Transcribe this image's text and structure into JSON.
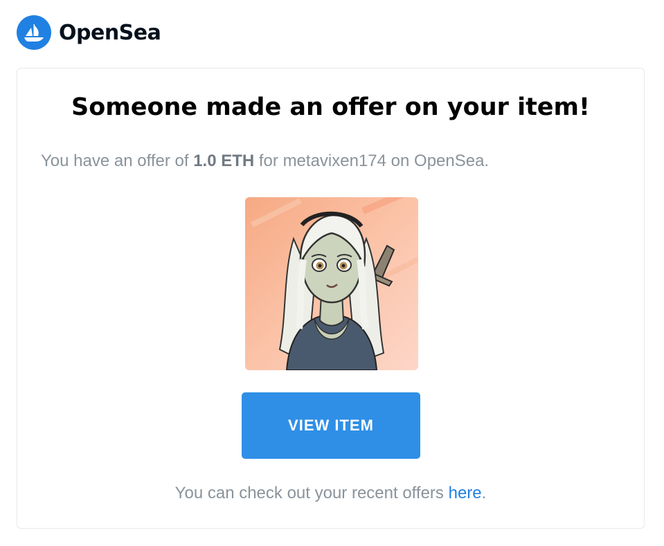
{
  "brand": {
    "name": "OpenSea",
    "logo_icon": "sailboat-icon",
    "color": "#2081e2"
  },
  "card": {
    "title": "Someone made an offer on your item!",
    "offer": {
      "prefix": "You have an offer of ",
      "amount": "1.0 ETH",
      "suffix": " for metavixen174 on OpenSea."
    },
    "nft_image": "metavixen174-artwork",
    "button_label": "VIEW ITEM",
    "button_color": "#2f8fe6",
    "footer": {
      "prefix": "You can check out your recent offers ",
      "link": "here",
      "suffix": "."
    }
  }
}
